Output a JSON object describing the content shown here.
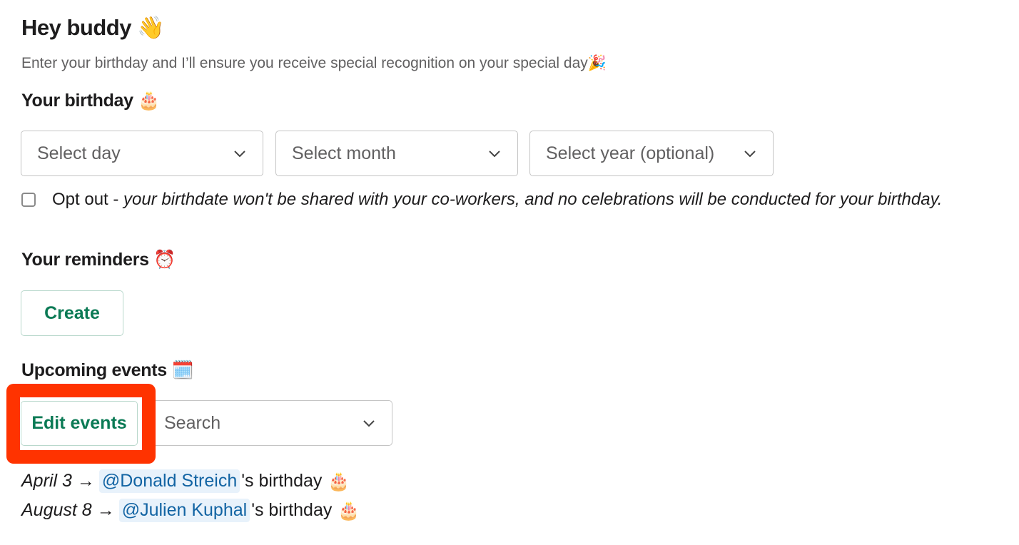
{
  "header": {
    "title": "Hey buddy",
    "title_emoji": "👋",
    "subtitle": "Enter your birthday and I’ll ensure you receive special recognition on your special day",
    "subtitle_emoji": "🎉"
  },
  "birthday": {
    "heading": "Your birthday",
    "heading_emoji": "🎂",
    "selects": [
      {
        "placeholder": "Select day"
      },
      {
        "placeholder": "Select month"
      },
      {
        "placeholder": "Select year (optional)"
      }
    ],
    "opt_out": {
      "checked": false,
      "label": "Opt out - ",
      "description": "your birthdate won't be shared with your co-workers, and no celebrations will be conducted for your birthday."
    }
  },
  "reminders": {
    "heading": "Your reminders",
    "heading_emoji": "⏰",
    "create_label": "Create"
  },
  "events": {
    "heading": "Upcoming events",
    "heading_emoji": "🗓️",
    "edit_label": "Edit events",
    "search_placeholder": "Search",
    "items": [
      {
        "date": "April 3",
        "arrow": "→",
        "mention": "@Donald Streich",
        "suffix": "'s birthday",
        "emoji": "🎂"
      },
      {
        "date": "August 8",
        "arrow": "→",
        "mention": "@Julien Kuphal",
        "suffix": "'s birthday",
        "emoji": "🎂"
      }
    ]
  },
  "colors": {
    "accent_green": "#0b7a55",
    "highlight_red": "#ff3300",
    "mention_blue": "#1264a3",
    "mention_bg": "#e8f2fb"
  }
}
